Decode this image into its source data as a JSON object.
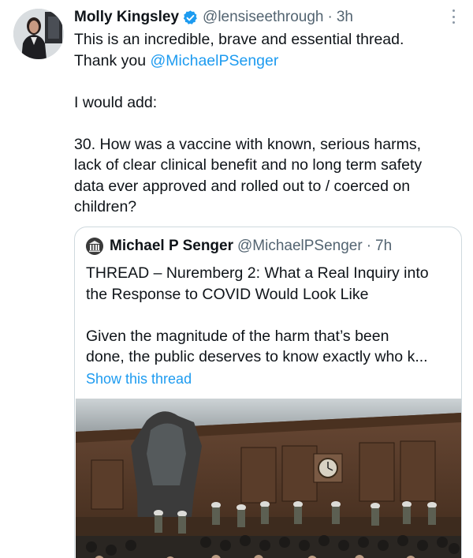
{
  "tweet": {
    "author_name": "Molly Kingsley",
    "author_handle": "@lensiseethrough",
    "separator": "·",
    "time": "3h",
    "avatar_icon": "profile-photo",
    "verified_icon": "verified-badge-icon",
    "more_icon": "more-options-icon",
    "body": {
      "line1": "This is an incredible, brave and essential thread.",
      "line2_prefix": "Thank you ",
      "line2_mention": "@MichaelPSenger",
      "line3": "I would add:",
      "line4": "30. How was a vaccine with known, serious harms,",
      "line5": "lack of clear clinical benefit and no long term safety",
      "line6": "data ever approved and rolled out to / coerced on",
      "line7": "children?"
    }
  },
  "quote": {
    "author_name": "Michael P Senger",
    "author_handle": "@MichaelPSenger",
    "separator": "·",
    "time": "7h",
    "title_line1": "THREAD – Nuremberg 2: What a Real Inquiry into",
    "title_line2": "the Response to COVID Would Look Like",
    "text_line1": "Given the magnitude of the harm that’s been",
    "text_line2": "done, the public deserves to know exactly who k...",
    "show_thread": "Show this thread",
    "image_description_icon": "courtroom-photo"
  },
  "colors": {
    "link": "#1d9bf0",
    "secondary_text": "#536471",
    "primary_text": "#0f1419",
    "border": "#cfd9de"
  }
}
